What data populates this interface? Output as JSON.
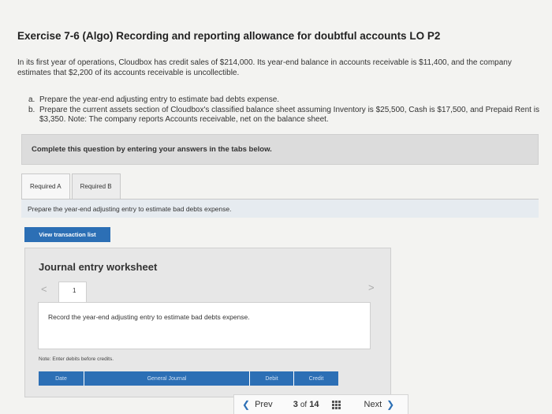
{
  "exercise": {
    "title": "Exercise 7-6 (Algo) Recording and reporting allowance for doubtful accounts LO P2",
    "intro": "In its first year of operations, Cloudbox has credit sales of $214,000. Its year-end balance in accounts receivable is $11,400, and the company estimates that $2,200 of its accounts receivable is uncollectible.",
    "tasks": [
      {
        "letter": "a.",
        "text": "Prepare the year-end adjusting entry to estimate bad debts expense."
      },
      {
        "letter": "b.",
        "text": "Prepare the current assets section of Cloudbox's classified balance sheet assuming Inventory is $25,500, Cash is $17,500, and Prepaid Rent is $3,350. Note: The company reports Accounts receivable, net on the balance sheet."
      }
    ]
  },
  "banner": "Complete this question by entering your answers in the tabs below.",
  "tabs": [
    "Required A",
    "Required B"
  ],
  "instruction": "Prepare the year-end adjusting entry to estimate bad debts expense.",
  "view_button": "View transaction list",
  "worksheet": {
    "title": "Journal entry worksheet",
    "nav_prev": "<",
    "nav_next": ">",
    "entry_number": "1",
    "record_text": "Record the year-end adjusting entry to estimate bad debts expense.",
    "note": "Note: Enter debits before credits.",
    "columns": [
      "Date",
      "General Journal",
      "Debit",
      "Credit"
    ]
  },
  "pagination": {
    "prev": "Prev",
    "current": "3",
    "of_label": "of",
    "total": "14",
    "next": "Next"
  }
}
